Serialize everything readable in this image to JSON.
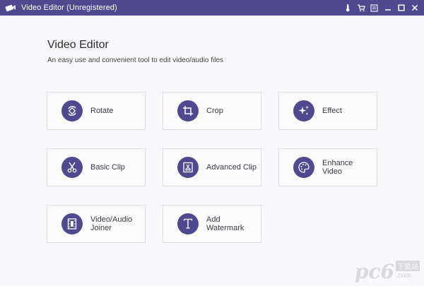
{
  "window": {
    "title": "Video Editor (Unregistered)"
  },
  "header": {
    "title": "Video Editor",
    "subtitle": "An easy use and convenient tool to edit video/audio files"
  },
  "tools": [
    {
      "label": "Rotate",
      "icon": "rotate-icon"
    },
    {
      "label": "Crop",
      "icon": "crop-icon"
    },
    {
      "label": "Effect",
      "icon": "sparkle-icon"
    },
    {
      "label": "Basic Clip",
      "icon": "scissors-icon"
    },
    {
      "label": "Advanced Clip",
      "icon": "advanced-clip-icon"
    },
    {
      "label": "Enhance\nVideo",
      "icon": "palette-icon"
    },
    {
      "label": "Video/Audio\nJoiner",
      "icon": "film-icon"
    },
    {
      "label": "Add\nWatermark",
      "icon": "text-t-icon"
    }
  ],
  "watermark": {
    "text": "pc6",
    "sub": "下载站",
    "domain": ".com"
  },
  "colors": {
    "accent": "#4f4a8f",
    "background": "#f8f8fa",
    "card_border": "#dcdce3"
  }
}
